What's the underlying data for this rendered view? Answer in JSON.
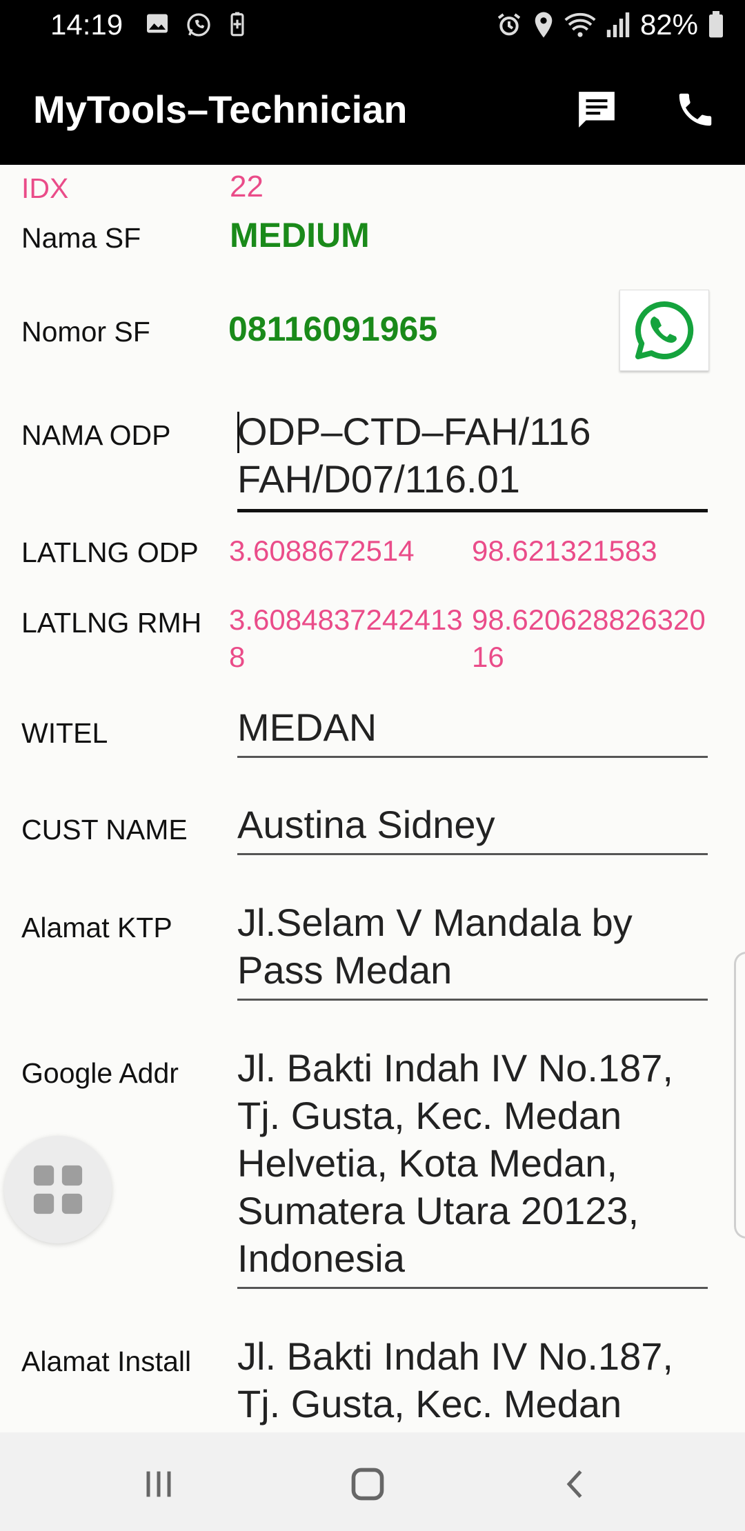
{
  "status_bar": {
    "time": "14:19",
    "battery": "82%",
    "icons_left": [
      "image-icon",
      "whatsapp-icon",
      "battery-saver-icon"
    ],
    "icons_right": [
      "alarm-icon",
      "location-icon",
      "wifi-icon",
      "signal-icon",
      "battery-icon"
    ]
  },
  "app_bar": {
    "title": "MyTools–Technician",
    "actions": [
      "message-icon",
      "phone-icon"
    ]
  },
  "colors": {
    "accent_pink": "#ea4c89",
    "accent_green": "#1a8a1a",
    "bar": "#000000"
  },
  "form": {
    "idx": {
      "label": "IDX",
      "value": "22"
    },
    "nama_sf": {
      "label": "Nama SF",
      "value": "MEDIUM"
    },
    "nomor_sf": {
      "label": "Nomor SF",
      "value": "08116091965"
    },
    "nama_odp": {
      "label": "NAMA ODP",
      "value": "ODP–CTD–FAH/116 FAH/D07/116.01"
    },
    "latlng_odp": {
      "label": "LATLNG ODP",
      "lat": "3.6088672514",
      "lng": "98.621321583"
    },
    "latlng_rmh": {
      "label": "LATLNG RMH",
      "lat": "3.60848372424138",
      "lng": "98.62062882632016"
    },
    "witel": {
      "label": "WITEL",
      "value": "MEDAN"
    },
    "cust_name": {
      "label": "CUST NAME",
      "value": "Austina Sidney"
    },
    "alamat_ktp": {
      "label": "Alamat KTP",
      "value": "Jl.Selam V Mandala by Pass Medan"
    },
    "google_addr": {
      "label": "Google Addr",
      "value": "Jl. Bakti Indah IV No.187, Tj. Gusta, Kec. Medan Helvetia, Kota Medan, Sumatera Utara 20123, Indonesia"
    },
    "alamat_install": {
      "label": "Alamat Install",
      "value": "Jl. Bakti Indah IV No.187, Tj. Gusta, Kec. Medan"
    }
  },
  "nav_bar": {
    "buttons": [
      "recent-apps-icon",
      "home-icon",
      "back-icon"
    ]
  }
}
